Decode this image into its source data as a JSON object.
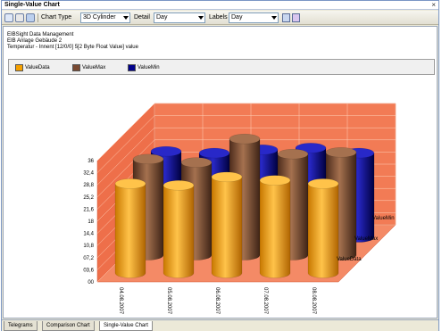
{
  "window": {
    "title": "Single-Value Chart",
    "close": "×"
  },
  "toolbar": {
    "chart_type_label": "Chart Type",
    "chart_type_value": "3D Cylinder",
    "detail_label": "Detail",
    "detail_value": "Day",
    "labels_label": "Labels",
    "labels_value": "Day"
  },
  "info": {
    "line1": "EIBSight Data Management",
    "line2": "EIB Anlage Gebäude 2",
    "line3": "Temperatur - Innent [12/0/0] 5[2 Byte Float Value] value"
  },
  "legend": {
    "items": [
      {
        "label": "ValueData",
        "color": "#f5a000"
      },
      {
        "label": "ValueMax",
        "color": "#7a4a32"
      },
      {
        "label": "ValueMin",
        "color": "#00008b"
      }
    ]
  },
  "chart_data": {
    "type": "bar",
    "style": "3D cylinder",
    "categories": [
      "04.08.2007",
      "05.08.2007",
      "06.08.2007",
      "07.08.2007",
      "08.08.2007"
    ],
    "series": [
      {
        "name": "ValueData",
        "values": [
          26.5,
          26.0,
          28.5,
          27.5,
          26.5
        ]
      },
      {
        "name": "ValueMax",
        "values": [
          28.5,
          27.5,
          34.5,
          30.0,
          30.5
        ]
      },
      {
        "name": "ValueMin",
        "values": [
          25.5,
          25.0,
          26.0,
          26.5,
          25.0
        ]
      }
    ],
    "y_ticks": [
      "00",
      "03,6",
      "07,2",
      "10,8",
      "14,4",
      "18",
      "21,6",
      "25,2",
      "28,8",
      "32,4",
      "36"
    ],
    "ylim": [
      0,
      36
    ],
    "depth_labels": [
      "ValueMin",
      "ValueMax",
      "ValueData"
    ],
    "colors": {
      "wall": "#f27b55",
      "grid": "#ffd0b8"
    }
  },
  "tabs": [
    "Telegrams",
    "Comparison Chart",
    "Single-Value Chart"
  ]
}
